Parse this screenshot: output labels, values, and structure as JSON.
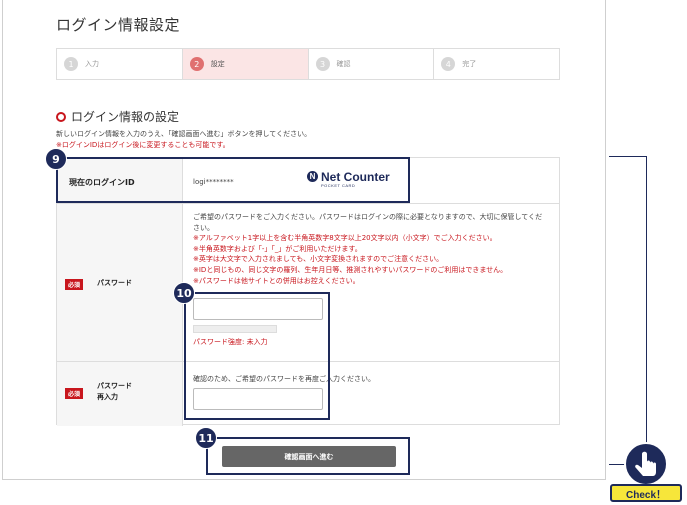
{
  "page": {
    "title": "ログイン情報設定"
  },
  "steps": [
    {
      "num": "1",
      "label": "入力",
      "active": false
    },
    {
      "num": "2",
      "label": "設定",
      "active": true
    },
    {
      "num": "3",
      "label": "確認",
      "active": false
    },
    {
      "num": "4",
      "label": "完了",
      "active": false
    }
  ],
  "section": {
    "title": "ログイン情報の設定",
    "desc_line1": "新しいログイン情報を入力のうえ、「確認画面へ進む」ボタンを押してください。",
    "desc_line2": "※ログインIDはログイン後に変更することも可能です。"
  },
  "current_login": {
    "label": "現在のログインID",
    "value": "logi********",
    "logo_text": "Net Counter",
    "logo_sub": "POCKET CARD"
  },
  "password": {
    "required": "必須",
    "label": "パスワード",
    "info_line1": "ご希望のパスワードをご入力ください。パスワードはログインの際に必要となりますので、大切に保管してくだ",
    "info_line2": "さい。",
    "note1": "※アルファベット1字以上を含む半角英数字8文字以上20文字以内（小文字）でご入力ください。",
    "note2": "※半角英数字および「-」「_」がご利用いただけます。",
    "note3": "※英字は大文字で入力されましても、小文字変換されますのでご注意ください。",
    "note4": "※IDと同じもの、同じ文字の羅列、生年月日等、推測されやすいパスワードのご利用はできません。",
    "note5": "※パスワードは他サイトとの併用はお控えください。",
    "value": "",
    "strength_label": "パスワード強度: 未入力"
  },
  "password_confirm": {
    "required": "必須",
    "label_line1": "パスワード",
    "label_line2": "再入力",
    "info": "確認のため、ご希望のパスワードを再度ご入力ください。",
    "value": ""
  },
  "submit": {
    "label": "確認画面へ進む"
  },
  "callouts": {
    "c9": "9",
    "c10": "10",
    "c11": "11"
  },
  "check": {
    "label": "Check！"
  },
  "colors": {
    "accent": "#c8161d",
    "navy": "#1e2a5a",
    "step_active_bg": "#fbe5e5",
    "check_yellow": "#f7e63a"
  }
}
